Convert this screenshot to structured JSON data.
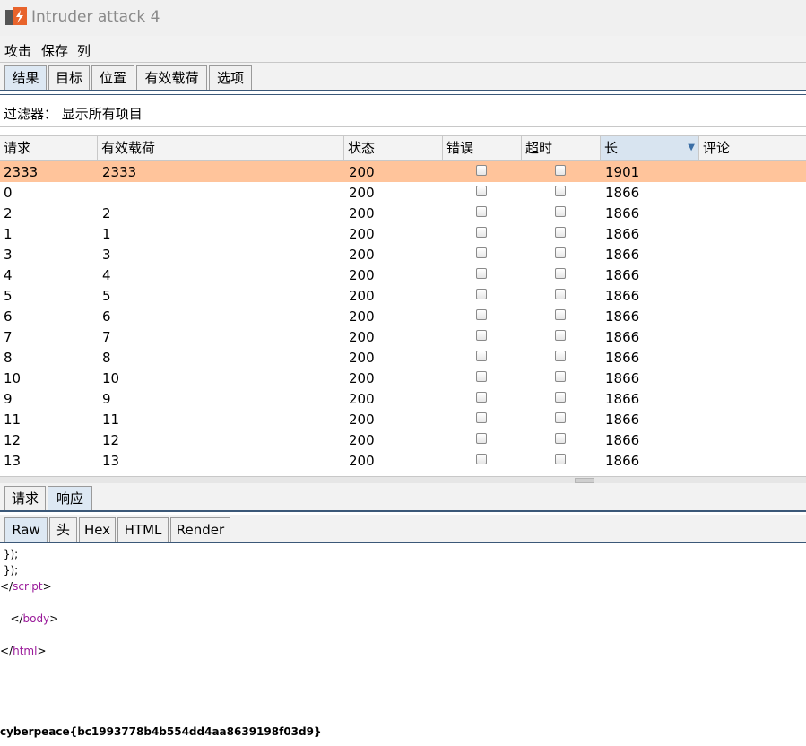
{
  "window": {
    "title": "Intruder attack 4"
  },
  "menu": [
    "攻击",
    "保存",
    "列"
  ],
  "tabs": [
    "结果",
    "目标",
    "位置",
    "有效载荷",
    "选项"
  ],
  "filter": {
    "text": "过滤器： 显示所有项目"
  },
  "table": {
    "columns": [
      "请求",
      "有效载荷",
      "状态",
      "错误",
      "超时",
      "长",
      "评论"
    ],
    "sorted_column": "长",
    "rows": [
      {
        "request": "2333",
        "payload": "2333",
        "status": "200",
        "error": false,
        "timeout": false,
        "length": "1901",
        "comment": "",
        "highlight": true
      },
      {
        "request": "0",
        "payload": "",
        "status": "200",
        "error": false,
        "timeout": false,
        "length": "1866",
        "comment": ""
      },
      {
        "request": "2",
        "payload": "2",
        "status": "200",
        "error": false,
        "timeout": false,
        "length": "1866",
        "comment": ""
      },
      {
        "request": "1",
        "payload": "1",
        "status": "200",
        "error": false,
        "timeout": false,
        "length": "1866",
        "comment": ""
      },
      {
        "request": "3",
        "payload": "3",
        "status": "200",
        "error": false,
        "timeout": false,
        "length": "1866",
        "comment": ""
      },
      {
        "request": "4",
        "payload": "4",
        "status": "200",
        "error": false,
        "timeout": false,
        "length": "1866",
        "comment": ""
      },
      {
        "request": "5",
        "payload": "5",
        "status": "200",
        "error": false,
        "timeout": false,
        "length": "1866",
        "comment": ""
      },
      {
        "request": "6",
        "payload": "6",
        "status": "200",
        "error": false,
        "timeout": false,
        "length": "1866",
        "comment": ""
      },
      {
        "request": "7",
        "payload": "7",
        "status": "200",
        "error": false,
        "timeout": false,
        "length": "1866",
        "comment": ""
      },
      {
        "request": "8",
        "payload": "8",
        "status": "200",
        "error": false,
        "timeout": false,
        "length": "1866",
        "comment": ""
      },
      {
        "request": "10",
        "payload": "10",
        "status": "200",
        "error": false,
        "timeout": false,
        "length": "1866",
        "comment": ""
      },
      {
        "request": "9",
        "payload": "9",
        "status": "200",
        "error": false,
        "timeout": false,
        "length": "1866",
        "comment": ""
      },
      {
        "request": "11",
        "payload": "11",
        "status": "200",
        "error": false,
        "timeout": false,
        "length": "1866",
        "comment": ""
      },
      {
        "request": "12",
        "payload": "12",
        "status": "200",
        "error": false,
        "timeout": false,
        "length": "1866",
        "comment": ""
      },
      {
        "request": "13",
        "payload": "13",
        "status": "200",
        "error": false,
        "timeout": false,
        "length": "1866",
        "comment": ""
      }
    ]
  },
  "lower_tabs": [
    "请求",
    "响应"
  ],
  "view_tabs": [
    "Raw",
    "头",
    "Hex",
    "HTML",
    "Render"
  ],
  "response": {
    "line1": " });",
    "line2": " });",
    "script_close": {
      "open": "</",
      "tag": "script",
      "close": ">"
    },
    "body_close": {
      "open": "   </",
      "tag": "body",
      "close": ">"
    },
    "html_close": {
      "open": "</",
      "tag": "html",
      "close": ">"
    },
    "flag": "cyberpeace{bc1993778b4b554dd4aa8639198f03d9}"
  },
  "colors": {
    "highlight_row": "#ffc49b",
    "active_tab": "#dde8f3",
    "tag": "#9a1a9a",
    "icon_orange": "#e8632b"
  },
  "icons": [
    "burp-app-icon",
    "sort-desc-icon",
    "checkbox-icon"
  ]
}
